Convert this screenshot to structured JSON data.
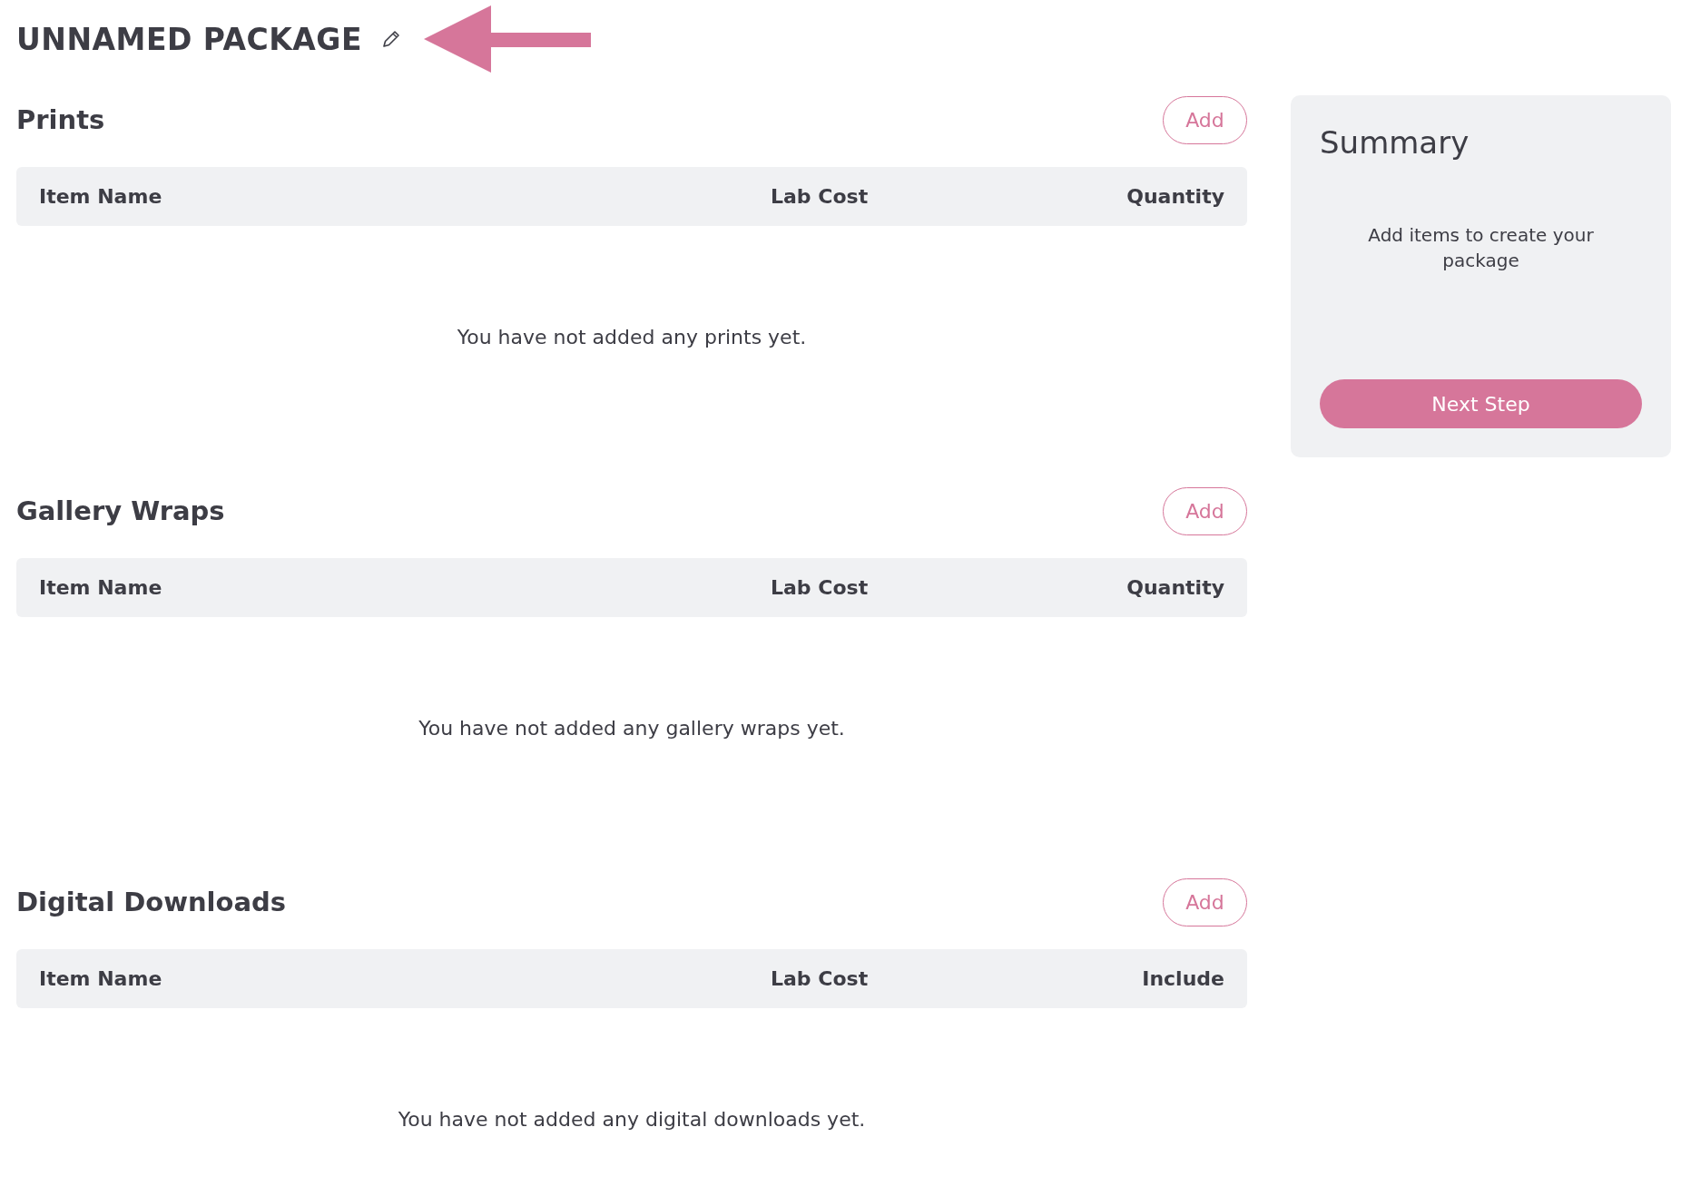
{
  "title": "UNNAMED PACKAGE",
  "sections": [
    {
      "heading": "Prints",
      "add_button": "Add",
      "columns": [
        "Item Name",
        "Lab Cost",
        "Quantity"
      ],
      "empty_message": "You have not added any prints yet."
    },
    {
      "heading": "Gallery Wraps",
      "add_button": "Add",
      "columns": [
        "Item Name",
        "Lab Cost",
        "Quantity"
      ],
      "empty_message": "You have not added any gallery wraps yet."
    },
    {
      "heading": "Digital Downloads",
      "add_button": "Add",
      "columns": [
        "Item Name",
        "Lab Cost",
        "Include"
      ],
      "empty_message": "You have not added any digital downloads yet."
    }
  ],
  "summary": {
    "title": "Summary",
    "message": "Add items to create your package",
    "button": "Next Step"
  }
}
